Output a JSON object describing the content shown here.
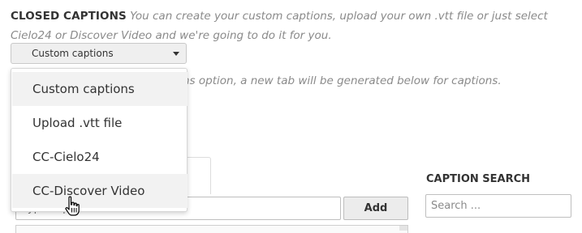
{
  "captions": {
    "title": "CLOSED CAPTIONS",
    "description": "You can create your custom captions, upload your own .vtt file or just select Cielo24 or Discover Video and we're going to do it for you.",
    "note": "ns option, a new tab will be generated below for captions."
  },
  "select": {
    "value": "Custom captions",
    "options": [
      {
        "label": "Custom captions",
        "state": "selected"
      },
      {
        "label": "Upload .vtt file",
        "state": ""
      },
      {
        "label": "CC-Cielo24",
        "state": ""
      },
      {
        "label": "CC-Discover Video",
        "state": "hovered"
      }
    ]
  },
  "tab": {
    "label_fragment": "n"
  },
  "editor": {
    "input_placeholder": "Type caption ...",
    "add_label": "Add"
  },
  "search": {
    "title": "CAPTION SEARCH",
    "placeholder": "Search ..."
  },
  "colors": {
    "hover_bg": "#f2f2f2",
    "muted_text": "#8a8a8a"
  }
}
